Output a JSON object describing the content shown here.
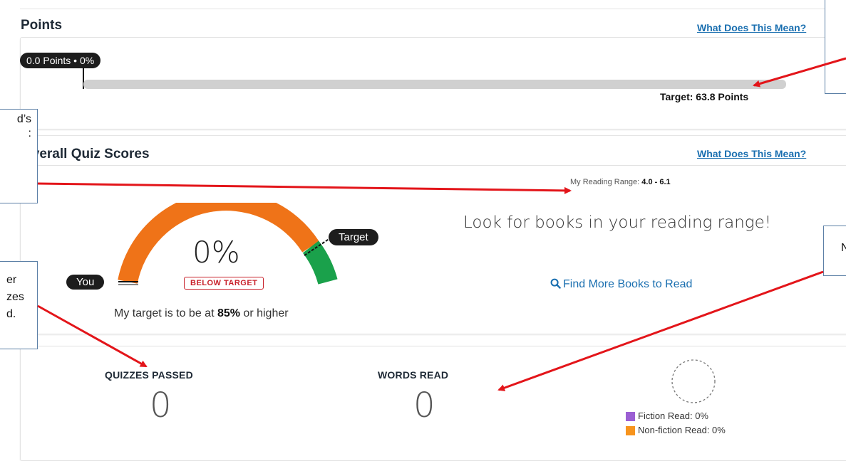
{
  "points": {
    "title": "Points",
    "help_link": "What Does This Mean?",
    "current_label": "0.0 Points • 0%",
    "progress_fraction": 0.0,
    "target_label": "Target: 63.8 Points"
  },
  "quiz": {
    "title": "Overall Quiz Scores",
    "help_link": "What Does This Mean?",
    "reading_range_label": "My Reading Range: ",
    "reading_range_value": "4.0 - 6.1",
    "score_percent": "0%",
    "status_badge": "BELOW TARGET",
    "you_label": "You",
    "target_label": "Target",
    "target_text_prefix": "My target is to be at ",
    "target_text_value": "85%",
    "target_text_suffix": " or higher",
    "prompt": "Look for books in your reading range!",
    "find_books_link": "Find More Books to Read"
  },
  "stats": {
    "quizzes_passed_label": "QUIZZES PASSED",
    "quizzes_passed_value": "0",
    "words_read_label": "WORDS READ",
    "words_read_value": "0",
    "fiction_label": "Fiction Read: 0%",
    "nonfiction_label": "Non-fiction Read: 0%"
  },
  "callouts": {
    "left_top_text": "d’s\n:",
    "left_bottom_text": "er\nzes\nd.",
    "right_mid_text": "N"
  },
  "colors": {
    "arc_orange": "#ef7318",
    "arc_green": "#1aa14b",
    "badge_red": "#c8202a",
    "link_blue": "#1a6fb0",
    "fiction": "#9b5fd3",
    "nonfiction": "#f7941d",
    "arrow_red": "#e3151a"
  }
}
